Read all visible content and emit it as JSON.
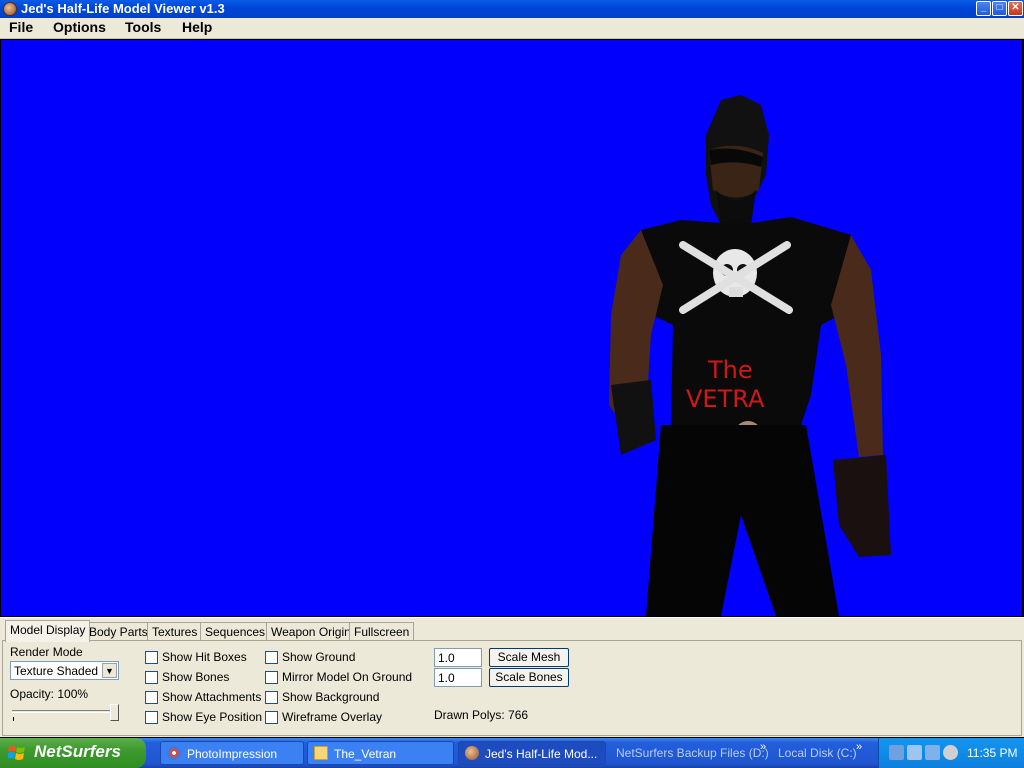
{
  "window": {
    "title": "Jed's Half-Life Model Viewer v1.3",
    "controls": {
      "minimize": "_",
      "maximize": "□",
      "close": "✕"
    }
  },
  "menu": [
    "File",
    "Options",
    "Tools",
    "Help"
  ],
  "viewport": {
    "background_color": "#0000fc",
    "model_shirt_text": "The VETRA"
  },
  "tabs": [
    "Model Display",
    "Body Parts",
    "Textures",
    "Sequences",
    "Weapon Origin",
    "Fullscreen"
  ],
  "model_display": {
    "render_mode_label": "Render Mode",
    "render_mode_value": "Texture Shaded",
    "opacity_label": "Opacity: 100%",
    "opacity_value": 1.0,
    "checkboxes_col1": [
      "Show Hit Boxes",
      "Show Bones",
      "Show Attachments",
      "Show Eye Position"
    ],
    "checkboxes_col2": [
      "Show Ground",
      "Mirror Model On Ground",
      "Show Background",
      "Wireframe Overlay"
    ],
    "scale_mesh_value": "1.0",
    "scale_mesh_button": "Scale Mesh",
    "scale_bones_value": "1.0",
    "scale_bones_button": "Scale Bones",
    "drawn_polys": "Drawn Polys: 766"
  },
  "taskbar": {
    "start_label": "NetSurfers",
    "tasks": [
      "PhotoImpression",
      "The_Vetran",
      "Jed's Half-Life Mod..."
    ],
    "toolbar_links": [
      "NetSurfers Backup Files (D:)",
      "Local Disk (C:)"
    ],
    "clock": "11:35 PM"
  }
}
